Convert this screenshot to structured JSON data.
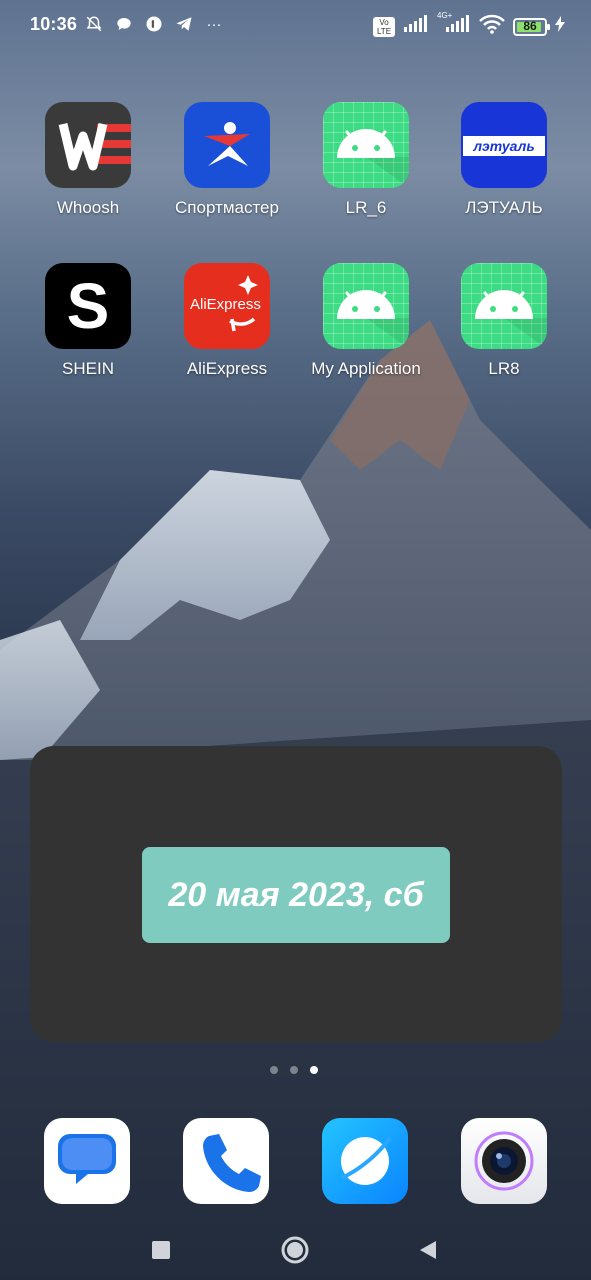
{
  "status_bar": {
    "time": "10:36",
    "battery_level": "86",
    "network": "4G+",
    "volte": "Vo LTE",
    "more": "···"
  },
  "apps": [
    {
      "label": "Whoosh",
      "icon": "whoosh-icon"
    },
    {
      "label": "Спортмастер",
      "icon": "sportmaster-icon"
    },
    {
      "label": "LR_6",
      "icon": "android-icon"
    },
    {
      "label": "ЛЭТУАЛЬ",
      "icon": "letual-icon"
    },
    {
      "label": "SHEIN",
      "icon": "shein-icon"
    },
    {
      "label": "AliExpress",
      "icon": "aliexpress-icon"
    },
    {
      "label": "My Application",
      "icon": "android-icon"
    },
    {
      "label": "LR8",
      "icon": "android-icon"
    }
  ],
  "icon_text": {
    "shein": "S",
    "aliexpress": "AliExpress",
    "letual": "лэтуаль"
  },
  "widget": {
    "date": "20 мая 2023, сб"
  },
  "page_indicator": {
    "count": 3,
    "active": 3
  },
  "dock": [
    {
      "icon": "messages-icon"
    },
    {
      "icon": "phone-icon"
    },
    {
      "icon": "browser-icon"
    },
    {
      "icon": "camera-icon"
    }
  ],
  "colors": {
    "widget_bg": "#333333",
    "date_box": "#7fcbc0",
    "android_green": "#3ddc84"
  }
}
